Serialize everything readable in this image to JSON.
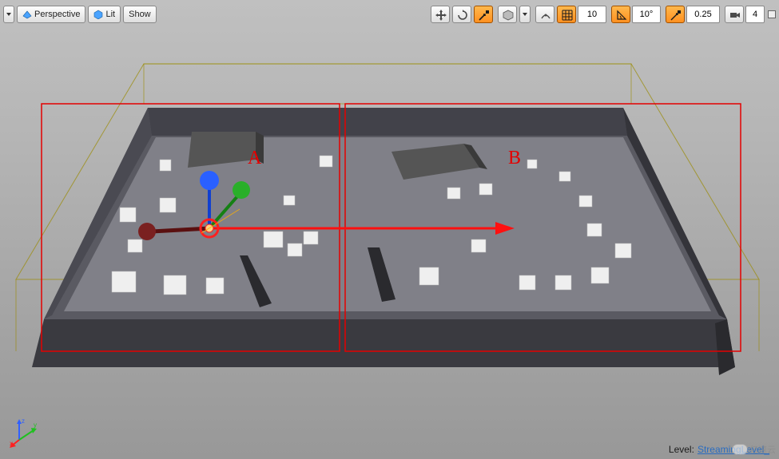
{
  "toolbar_left": {
    "perspective": "Perspective",
    "lit": "Lit",
    "show": "Show"
  },
  "toolbar_right": {
    "snap_pos": "10",
    "snap_rot": "10°",
    "snap_scale": "0.25",
    "cam_speed": "4"
  },
  "scene": {
    "zone_a": "A",
    "zone_b": "B"
  },
  "status": {
    "label": "Level:",
    "value": "StreamingLevel_"
  },
  "axes": {
    "x": "x",
    "y": "y",
    "z": "z"
  },
  "watermark": "亿速云"
}
